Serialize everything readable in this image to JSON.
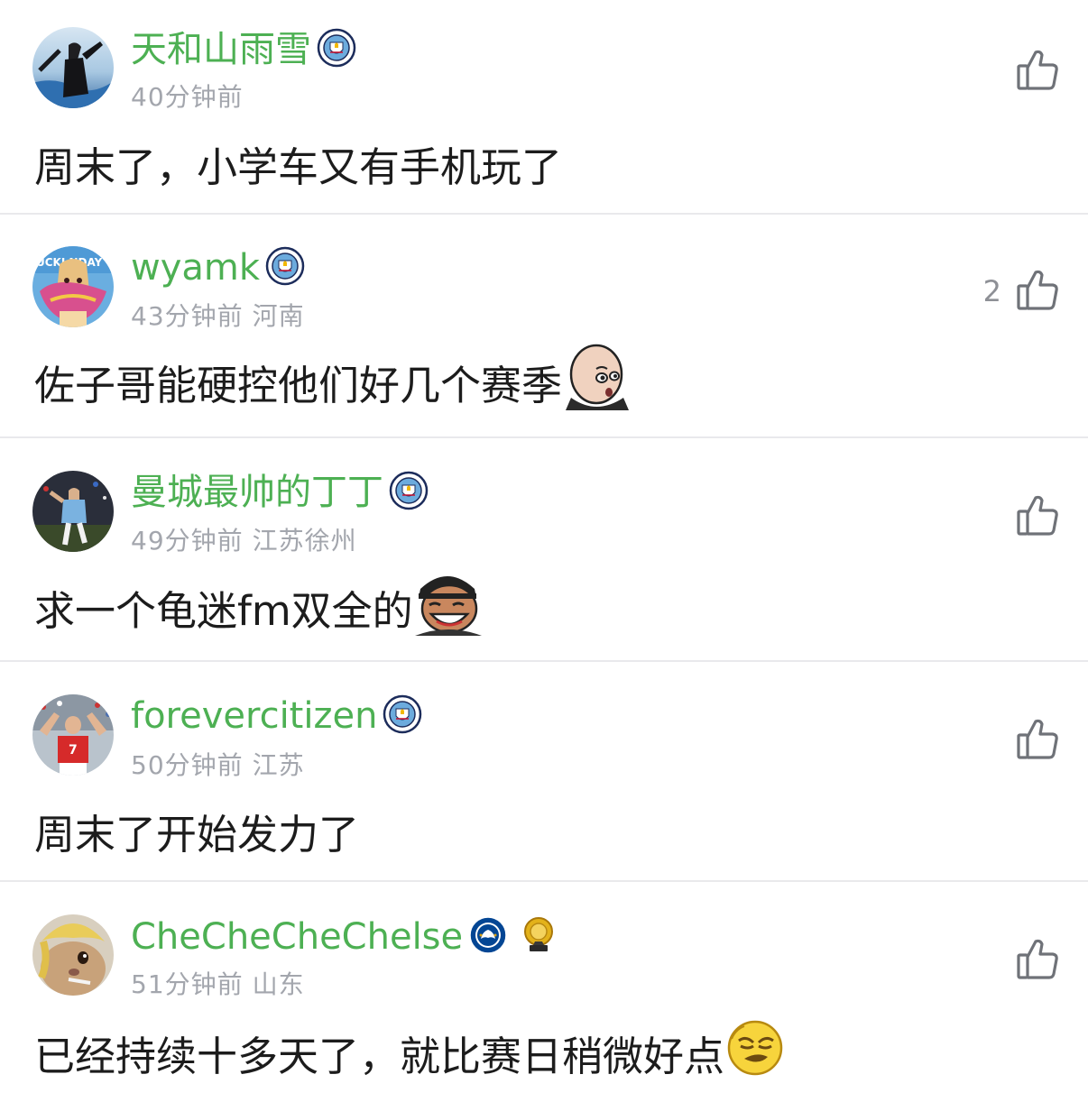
{
  "colors": {
    "username": "#4db053",
    "meta": "#a3a6ad",
    "text": "#1c1c1c",
    "divider": "#e9e9ec",
    "like_icon": "#6f7278"
  },
  "comments": [
    {
      "username": "天和山雨雪",
      "badges": [
        "man-city-badge-icon"
      ],
      "time": "40分钟前",
      "location": "",
      "text": "周末了，小学车又有手机玩了",
      "emoji": "",
      "likes": ""
    },
    {
      "username": "wyamk",
      "badges": [
        "man-city-badge-icon"
      ],
      "time": "43分钟前",
      "location": "河南",
      "text": "佐子哥能硬控他们好几个赛季",
      "emoji": "guardiola-face-sticker-icon",
      "likes": "2"
    },
    {
      "username": "曼城最帅的丁丁",
      "badges": [
        "man-city-badge-icon"
      ],
      "time": "49分钟前",
      "location": "江苏徐州",
      "text": "求一个龟迷fm双全的",
      "emoji": "laughing-man-sticker-icon",
      "likes": ""
    },
    {
      "username": "forevercitizen",
      "badges": [
        "man-city-badge-icon"
      ],
      "time": "50分钟前",
      "location": "江苏",
      "text": "周末了开始发力了",
      "emoji": "",
      "likes": ""
    },
    {
      "username": "CheCheCheChelse",
      "badges": [
        "chelsea-badge-icon",
        "gold-medal-icon"
      ],
      "time": "51分钟前",
      "location": "山东",
      "text": "已经持续十多天了，就比赛日稍微好点",
      "emoji": "smirk-emoji-icon",
      "likes": ""
    }
  ]
}
